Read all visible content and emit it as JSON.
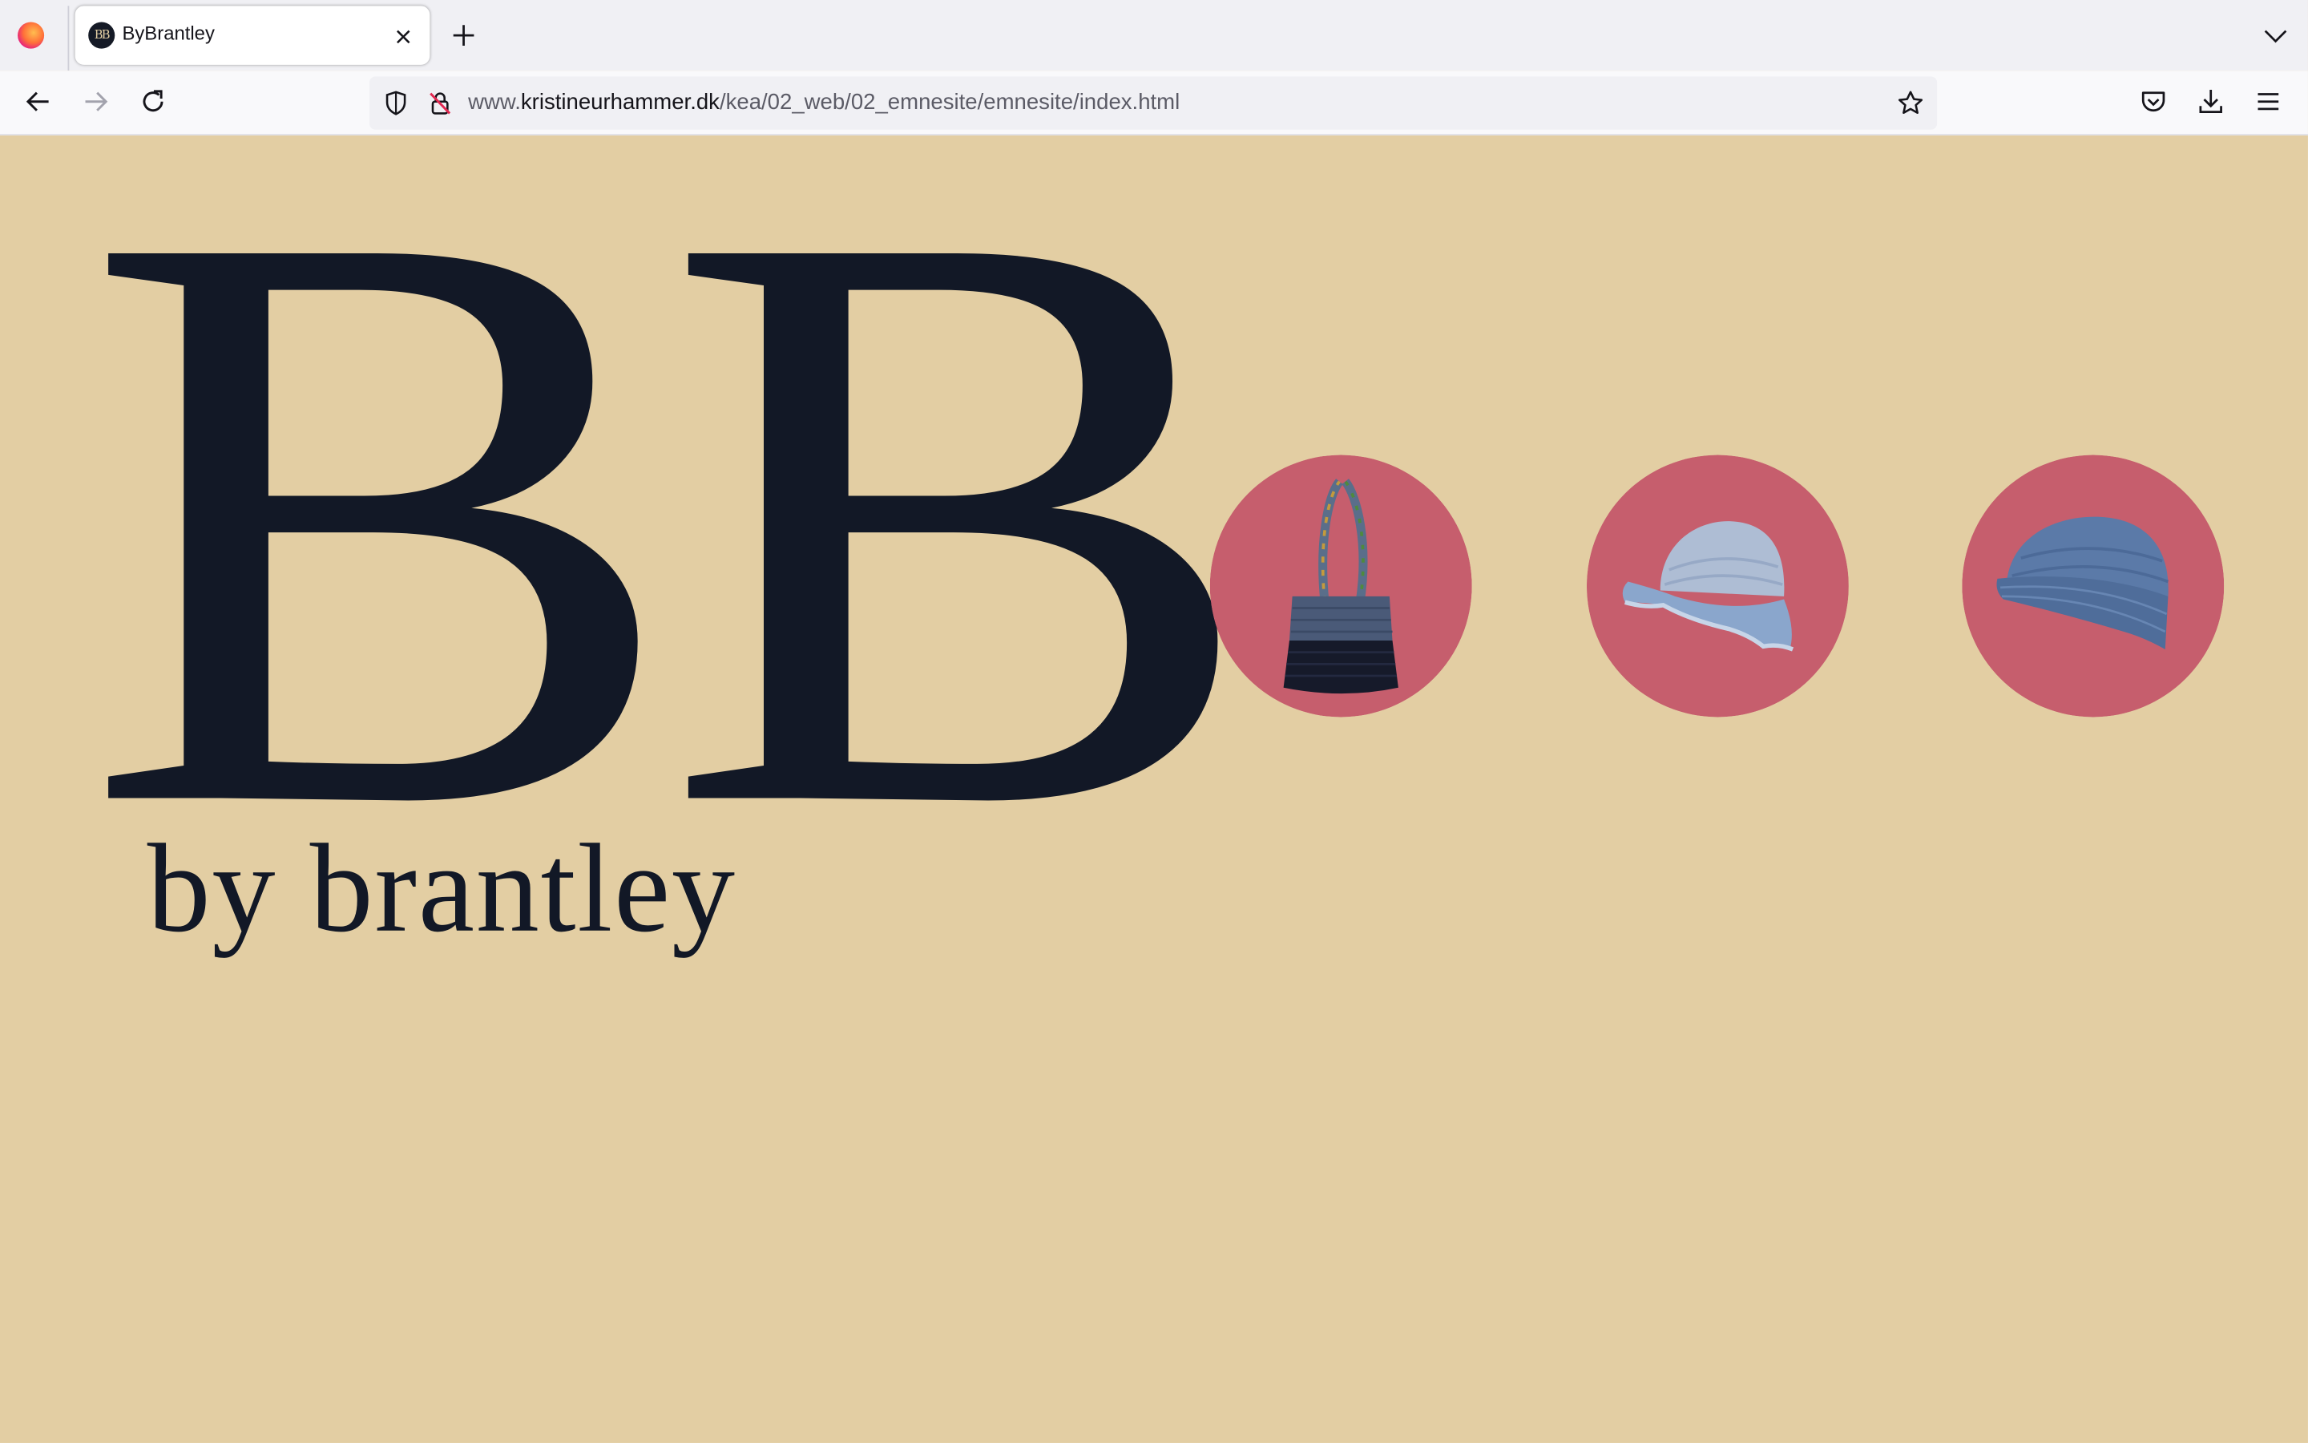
{
  "browser": {
    "tab": {
      "title": "ByBrantley",
      "favicon_text": "BB"
    },
    "url": {
      "prefix": "www.",
      "host": "kristineurhammer.dk",
      "path": "/kea/02_web/02_emnesite/emnesite/index.html"
    }
  },
  "page": {
    "logo": "BB",
    "tagline": "by brantley",
    "colors": {
      "background": "#e3cea3",
      "text": "#121826",
      "product_circle": "#c65e6d"
    },
    "products": [
      {
        "name": "crochet-bag",
        "icon": "bag-icon"
      },
      {
        "name": "bucket-hat",
        "icon": "bucket-hat-icon"
      },
      {
        "name": "beanie",
        "icon": "beanie-icon"
      }
    ]
  }
}
